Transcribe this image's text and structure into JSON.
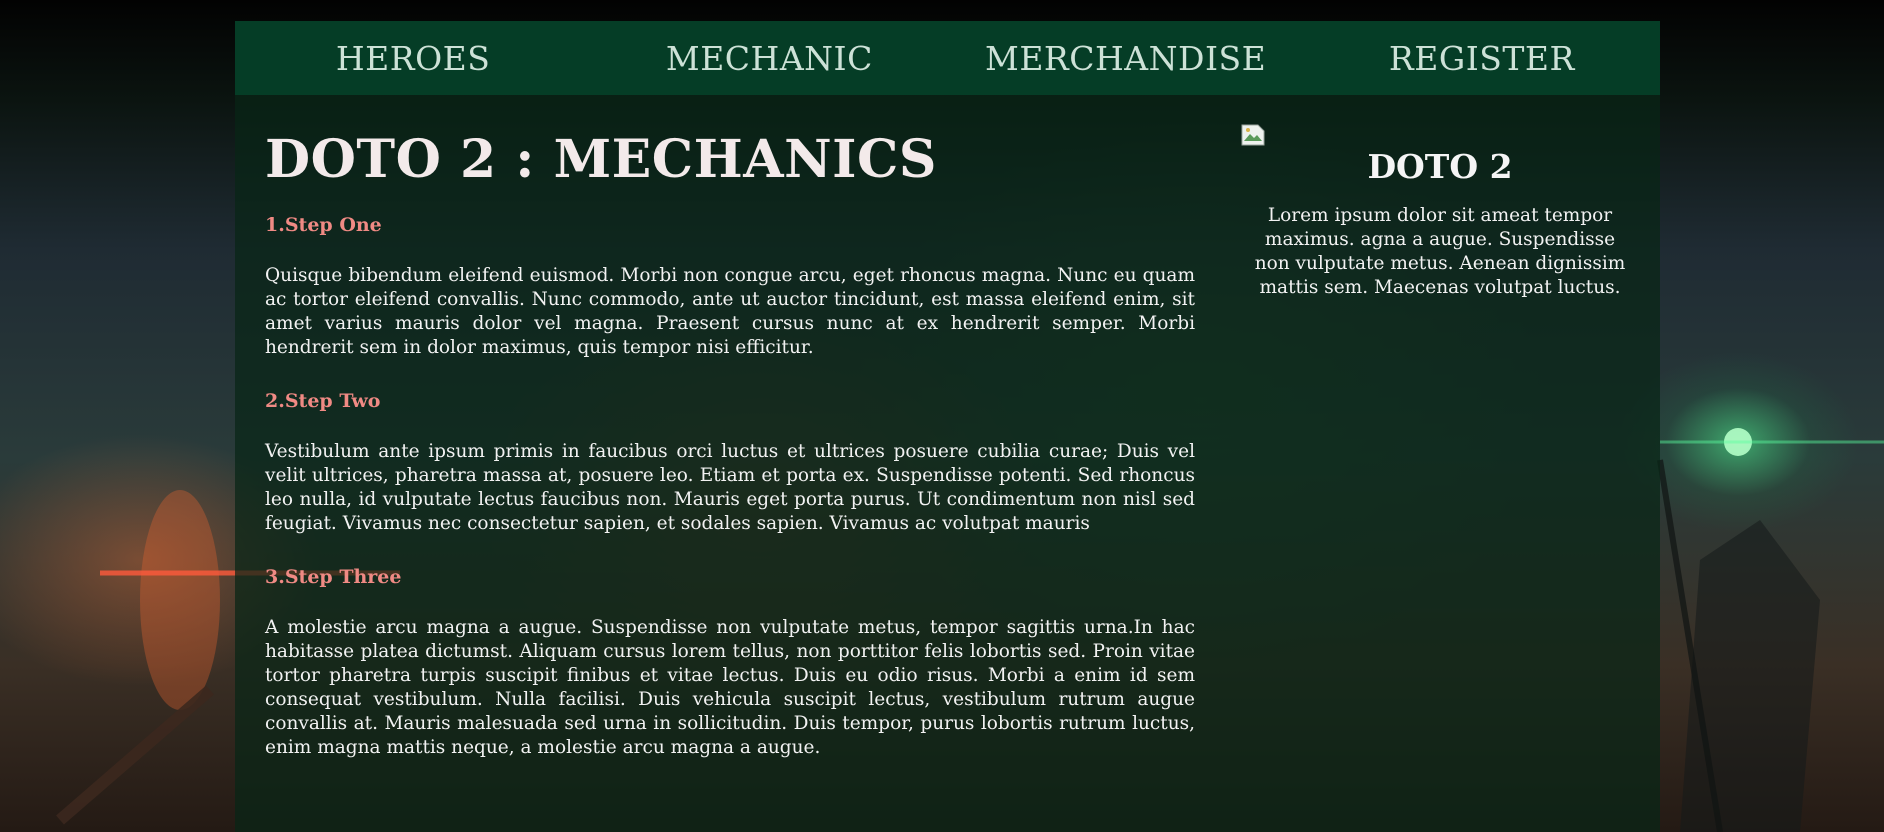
{
  "nav": {
    "items": [
      {
        "label": "HEROES"
      },
      {
        "label": "MECHANIC"
      },
      {
        "label": "MERCHANDISE"
      },
      {
        "label": "REGISTER"
      }
    ]
  },
  "main": {
    "title": "DOTO 2 : MECHANICS",
    "steps": [
      {
        "heading": "1.Step One",
        "text": "Quisque bibendum eleifend euismod. Morbi non congue arcu, eget rhoncus magna. Nunc eu quam ac tortor eleifend convallis. Nunc commodo, ante ut auctor tincidunt, est massa eleifend enim, sit amet varius mauris dolor vel magna. Praesent cursus nunc at ex hendrerit semper. Morbi hendrerit sem in dolor maximus, quis tempor nisi efficitur."
      },
      {
        "heading": "2.Step Two",
        "text": "Vestibulum ante ipsum primis in faucibus orci luctus et ultrices posuere cubilia curae; Duis vel velit ultrices, pharetra massa at, posuere leo. Etiam et porta ex. Suspendisse potenti. Sed rhoncus leo nulla, id vulputate lectus faucibus non. Mauris eget porta purus. Ut condimentum non nisl sed feugiat. Vivamus nec consectetur sapien, et sodales sapien. Vivamus ac volutpat mauris"
      },
      {
        "heading": "3.Step Three",
        "text": "A molestie arcu magna a augue. Suspendisse non vulputate metus, tempor sagittis urna.In hac habitasse platea dictumst. Aliquam cursus lorem tellus, non porttitor felis lobortis sed. Proin vitae tortor pharetra turpis suscipit finibus et vitae lectus. Duis eu odio risus. Morbi a enim id sem consequat vestibulum. Nulla facilisi. Duis vehicula suscipit lectus, vestibulum rutrum augue convallis at. Mauris malesuada sed urna in sollicitudin. Duis tempor, purus lobortis rutrum luctus, enim magna mattis neque, a molestie arcu magna a augue."
      }
    ]
  },
  "sidebar": {
    "image_icon": "broken-image-icon",
    "title": "DOTO 2",
    "text": "Lorem ipsum dolor sit ameat tempor maximus. agna a augue. Suspendisse non vulputate metus. Aenean dignissim mattis sem. Maecenas volutpat luctus."
  },
  "colors": {
    "nav_bg": "#053d26",
    "step_heading": "#f08a84",
    "body_text": "#f2f2f2"
  }
}
